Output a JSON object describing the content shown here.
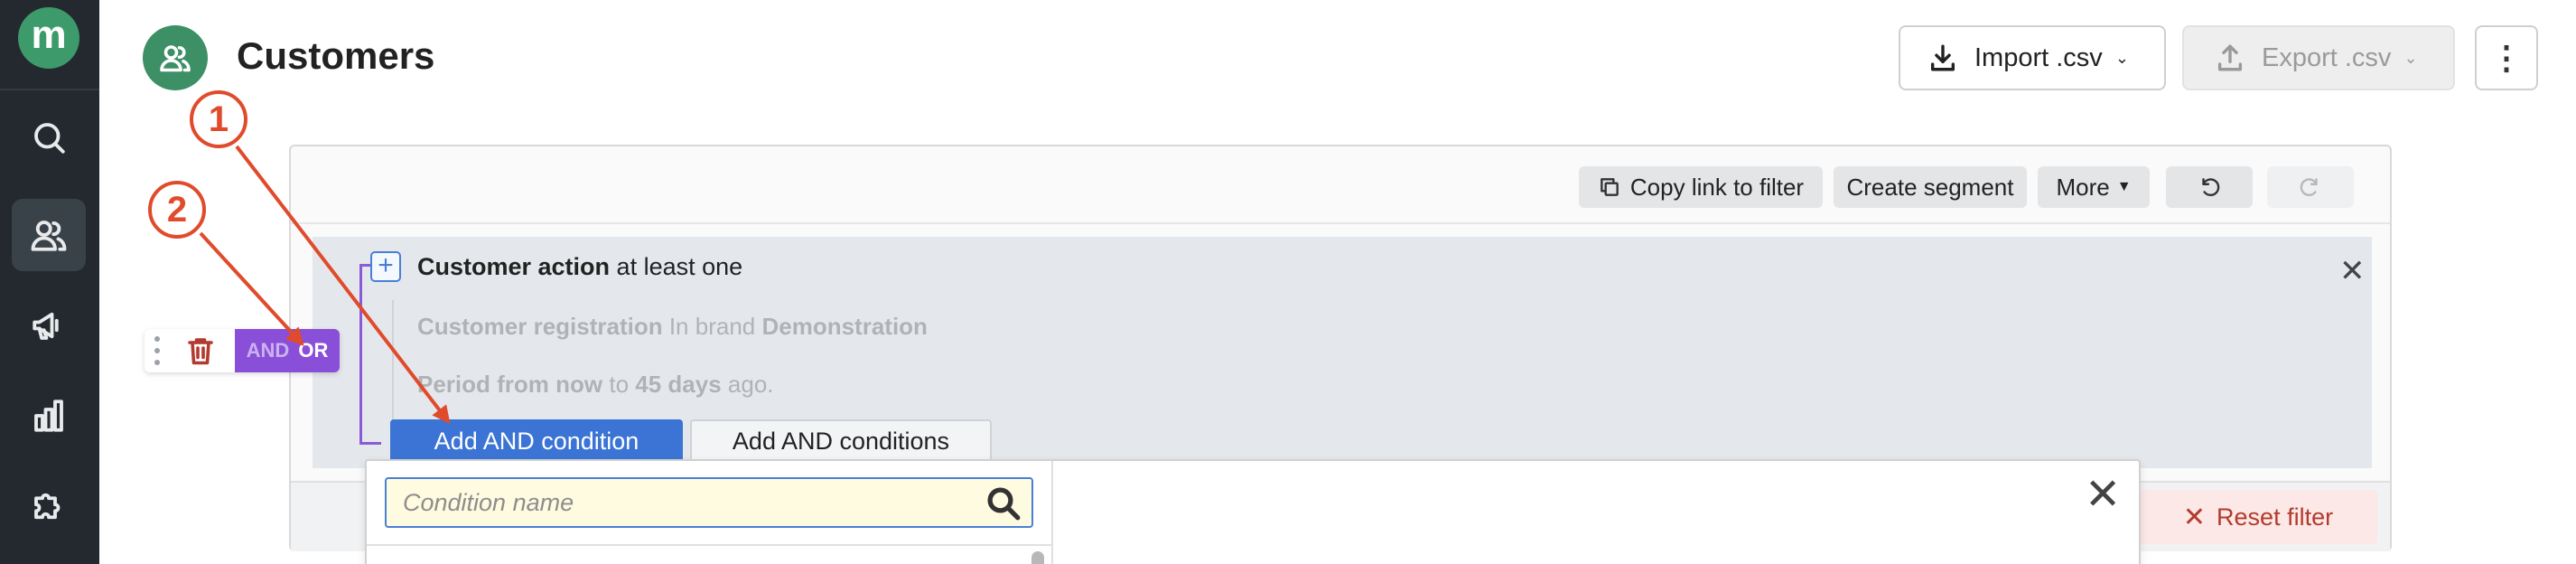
{
  "nav": {
    "logo_letter": "m",
    "items": [
      {
        "icon": "search-icon",
        "active": false
      },
      {
        "icon": "users-icon",
        "active": true
      },
      {
        "icon": "megaphone-icon",
        "active": false
      },
      {
        "icon": "bar-chart-icon",
        "active": false
      },
      {
        "icon": "puzzle-icon",
        "active": false
      }
    ]
  },
  "header": {
    "title": "Customers",
    "import_label": "Import .csv",
    "export_label": "Export .csv"
  },
  "toolbar": {
    "copy_link_label": "Copy link to filter",
    "create_segment_label": "Create segment",
    "more_label": "More"
  },
  "condition": {
    "title_bold": "Customer action",
    "title_rest": " at least one",
    "line1_bold1": "Customer registration",
    "line1_mid": " In brand ",
    "line1_bold2": "Demonstration",
    "line2_bold1": "Period from now",
    "line2_mid": " to ",
    "line2_bold2": "45 days",
    "line2_end": " ago."
  },
  "actions": {
    "add_and_condition": "Add AND condition",
    "add_and_conditions": "Add AND conditions",
    "reset_filter": "Reset filter"
  },
  "logic_toggle": {
    "and_label": "AND",
    "or_label": "OR"
  },
  "dropdown": {
    "search_placeholder": "Condition name"
  },
  "annotations": {
    "badge_1": "1",
    "badge_2": "2",
    "color": "#e04b2c"
  },
  "colors": {
    "nav_bg": "#23292f",
    "brand_green": "#3d9a6a",
    "primary_blue": "#3b74d4",
    "logic_purple": "#8a4fd8",
    "danger_red": "#b33a2e"
  }
}
